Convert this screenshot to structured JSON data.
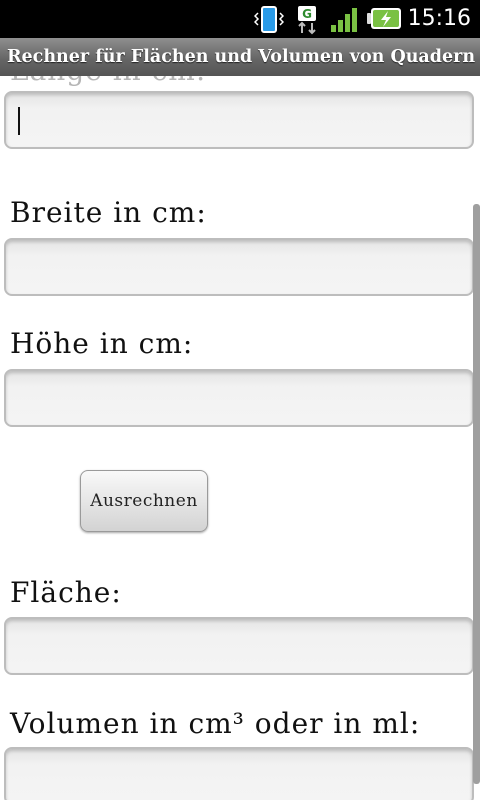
{
  "status_bar": {
    "time": "15:16",
    "data_network": "G",
    "icons": [
      "vibrate-icon",
      "g-data-icon",
      "signal-icon",
      "battery-charging-icon"
    ],
    "colors": {
      "background": "#000000",
      "signal": "#7ac143",
      "battery": "#7ac143"
    }
  },
  "title_bar": {
    "title": "Rechner für Flächen und Volumen von Quadern"
  },
  "form": {
    "laenge_label_partial": "Länge in cm:",
    "laenge_value": "",
    "breite_label": "Breite in cm:",
    "breite_value": "",
    "hoehe_label": "Höhe in cm:",
    "hoehe_value": "",
    "calculate_button": "Ausrechnen",
    "flaeche_label": "Fläche:",
    "flaeche_value": "",
    "volumen_label": "Volumen in cm³ oder in ml:",
    "volumen_value": ""
  }
}
